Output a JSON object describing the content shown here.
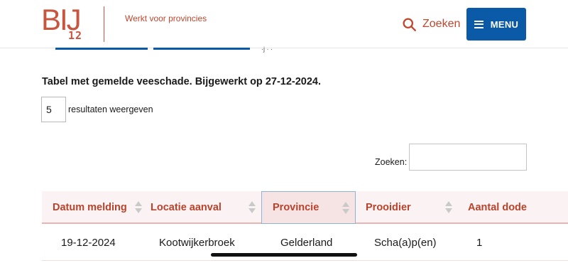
{
  "header": {
    "logo_big": "BIJ",
    "logo_small": "12",
    "tagline": "Werkt voor provincies",
    "search_label": "Zoeken",
    "menu_label": "MENU"
  },
  "peek": {
    "text": "·j · ·"
  },
  "content": {
    "caption": "Tabel met gemelde veeschade. Bijgewerkt op 27-12-2024.",
    "page_length_value": "5",
    "page_length_label": "resultaten weergeven",
    "filter_label": "Zoeken:",
    "filter_value": ""
  },
  "table": {
    "columns": [
      "Datum melding",
      "Locatie aanval",
      "Provincie",
      "Prooidier",
      "Aantal dode"
    ],
    "sorted_column": "Provincie",
    "rows": [
      [
        "19-12-2024",
        "Kootwijkerbroek",
        "Gelderland",
        "Scha(a)p(en)",
        "1"
      ]
    ]
  },
  "colors": {
    "brand_red": "#c0462e",
    "menu_blue": "#0a5aa8",
    "header_row_bg": "#fbf3f3"
  }
}
